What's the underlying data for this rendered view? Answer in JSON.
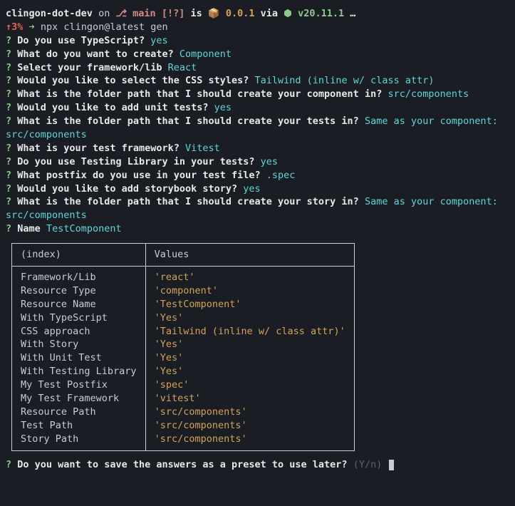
{
  "header": {
    "project": "clingon-dot-dev",
    "on": "on",
    "branch": "main",
    "branch_status": "[!?]",
    "is": "is",
    "box_emoji": "📦",
    "version": "0.0.1",
    "via": "via",
    "hex_emoji": "⬢",
    "node_version": "v20.11.1",
    "ellipsis": "…"
  },
  "cmdline": {
    "status": "↑3%",
    "arrow": "➜",
    "command": "npx clingon@latest gen"
  },
  "prompts": [
    {
      "q": "Do you use TypeScript?",
      "a": "yes",
      "cls": "cyan"
    },
    {
      "q": "What do you want to create?",
      "a": "Component",
      "cls": "cyan"
    },
    {
      "q": "Select your framework/lib",
      "a": "React",
      "cls": "cyan"
    },
    {
      "q": "Would you like to select the CSS styles?",
      "a": "Tailwind (inline w/ class attr)",
      "cls": "cyan"
    },
    {
      "q": "What is the folder path that I should create your component in?",
      "a": "src/components",
      "cls": "cyan"
    },
    {
      "q": "Would you like to add unit tests?",
      "a": "yes",
      "cls": "cyan"
    },
    {
      "q": "What is the folder path that I should create your tests in?",
      "a": "Same as your component: src/components",
      "cls": "cyan"
    },
    {
      "q": "What is your test framework?",
      "a": "Vitest",
      "cls": "cyan"
    },
    {
      "q": "Do you use Testing Library in your tests?",
      "a": "yes",
      "cls": "cyan"
    },
    {
      "q": "What postfix do you use in your test file?",
      "a": ".spec",
      "cls": "cyan"
    },
    {
      "q": "Would you like to add storybook story?",
      "a": "yes",
      "cls": "cyan"
    },
    {
      "q": "What is the folder path that I should create your story in?",
      "a": "Same as your component: src/components",
      "cls": "cyan"
    },
    {
      "q": "Name",
      "a": "TestComponent",
      "cls": "cyan"
    }
  ],
  "table": {
    "headers": {
      "index": "(index)",
      "values": "Values"
    },
    "rows": [
      {
        "k": "Framework/Lib",
        "v": "'react'"
      },
      {
        "k": "Resource Type",
        "v": "'component'"
      },
      {
        "k": "Resource Name",
        "v": "'TestComponent'"
      },
      {
        "k": "With TypeScript",
        "v": "'Yes'"
      },
      {
        "k": "CSS approach",
        "v": "'Tailwind (inline w/ class attr)'"
      },
      {
        "k": "With Story",
        "v": "'Yes'"
      },
      {
        "k": "With Unit Test",
        "v": "'Yes'"
      },
      {
        "k": "With Testing Library",
        "v": "'Yes'"
      },
      {
        "k": "My Test Postfix",
        "v": "'spec'"
      },
      {
        "k": "My Test Framework",
        "v": "'vitest'"
      },
      {
        "k": "Resource Path",
        "v": "'src/components'"
      },
      {
        "k": "Test Path",
        "v": "'src/components'"
      },
      {
        "k": "Story Path",
        "v": "'src/components'"
      }
    ]
  },
  "final": {
    "q": "Do you want to save the answers as a preset to use later?",
    "hint": "(Y/n)"
  }
}
